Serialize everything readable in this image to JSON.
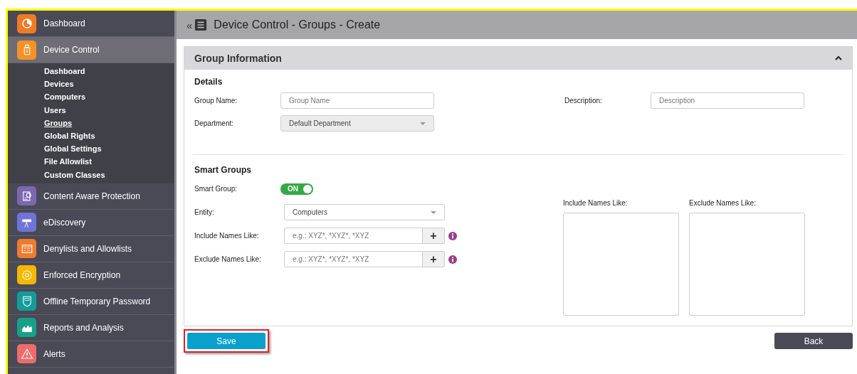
{
  "sidebar": {
    "items": [
      {
        "label": "Dashboard",
        "color": "#f07b22",
        "selected": false
      },
      {
        "label": "Device Control",
        "color": "#f39325",
        "selected": true,
        "expanded": true,
        "children": [
          {
            "label": "Dashboard",
            "selected": false
          },
          {
            "label": "Devices",
            "selected": false
          },
          {
            "label": "Computers",
            "selected": false
          },
          {
            "label": "Users",
            "selected": false
          },
          {
            "label": "Groups",
            "selected": true
          },
          {
            "label": "Global Rights",
            "selected": false
          },
          {
            "label": "Global Settings",
            "selected": false
          },
          {
            "label": "File Allowlist",
            "selected": false
          },
          {
            "label": "Custom Classes",
            "selected": false
          }
        ]
      },
      {
        "label": "Content Aware Protection",
        "color": "#7b68b0",
        "selected": false
      },
      {
        "label": "eDiscovery",
        "color": "#6f74d8",
        "selected": false
      },
      {
        "label": "Denylists and Allowlists",
        "color": "#ef7b2e",
        "selected": false
      },
      {
        "label": "Enforced Encryption",
        "color": "#f5b800",
        "selected": false
      },
      {
        "label": "Offline Temporary Password",
        "color": "#139c9a",
        "selected": false
      },
      {
        "label": "Reports and Analysis",
        "color": "#17a08a",
        "selected": false
      },
      {
        "label": "Alerts",
        "color": "#ee6b6b",
        "selected": false
      }
    ]
  },
  "header": {
    "collapse": "«",
    "title": "Device Control - Groups - Create"
  },
  "panel": {
    "title": "Group Information",
    "expanded": true,
    "details": {
      "heading": "Details",
      "group_name": {
        "label": "Group Name:",
        "placeholder": "Group Name"
      },
      "description": {
        "label": "Description:",
        "placeholder": "Description"
      },
      "department": {
        "label": "Department:",
        "value": "Default Department",
        "disabled": true
      }
    },
    "smart_groups": {
      "heading": "Smart Groups",
      "smart_group": {
        "label": "Smart Group:",
        "on": true,
        "text": "ON"
      },
      "entity": {
        "label": "Entity:",
        "value": "Computers"
      },
      "include": {
        "label": "Include Names Like:",
        "placeholder": "e.g.: XYZ*, *XYZ*, *XYZ",
        "button": "+"
      },
      "exclude": {
        "label": "Exclude Names Like:",
        "placeholder": "e.g.: XYZ*, *XYZ*, *XYZ",
        "button": "+"
      },
      "include_list": {
        "label": "Include Names Like:"
      },
      "exclude_list": {
        "label": "Exclude Names Like:"
      }
    }
  },
  "buttons": {
    "save": {
      "label": "Save",
      "highlighted": true
    },
    "back": {
      "label": "Back"
    }
  }
}
